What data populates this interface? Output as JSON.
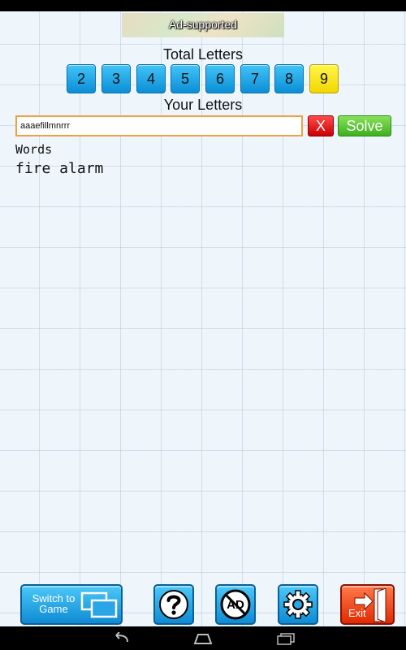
{
  "ad": {
    "label": "Ad-supported"
  },
  "total_letters": {
    "title": "Total Letters",
    "counts": [
      "2",
      "3",
      "4",
      "5",
      "6",
      "7",
      "8",
      "9"
    ],
    "selected": "9"
  },
  "your_letters": {
    "title": "Your Letters",
    "input_value": "aaaefillmnrrr",
    "clear_label": "X",
    "solve_label": "Solve"
  },
  "words": {
    "header": "Words",
    "items": [
      "fire alarm"
    ]
  },
  "toolbar": {
    "switch_label": "Switch to Game",
    "exit_label": "Exit",
    "icons": {
      "switch": "switch-windows-icon",
      "help": "question-mark-icon",
      "no_ads": "no-ads-icon",
      "settings": "gear-icon",
      "exit": "exit-door-icon"
    }
  },
  "colors": {
    "count_button": "#1fa6e8",
    "selected_count_button": "#f7e61a",
    "clear_button": "#e01515",
    "solve_button": "#5cc73a",
    "input_border": "#f0a040",
    "exit_button": "#f04a14"
  }
}
